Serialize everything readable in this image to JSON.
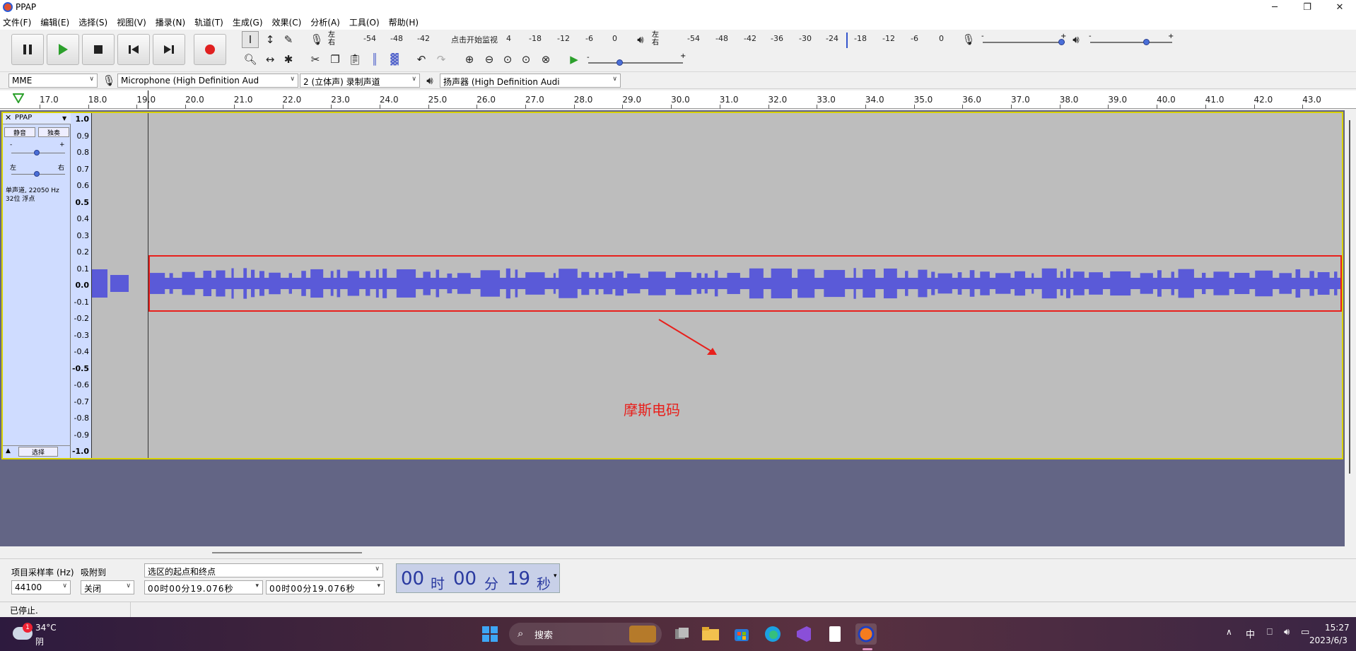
{
  "window": {
    "title": "PPAP"
  },
  "menu": [
    "文件(F)",
    "编辑(E)",
    "选择(S)",
    "视图(V)",
    "播录(N)",
    "轨道(T)",
    "生成(G)",
    "效果(C)",
    "分析(A)",
    "工具(O)",
    "帮助(H)"
  ],
  "meter": {
    "rec_label_top": "左",
    "rec_label_bottom": "右",
    "rec_scale": [
      "-54",
      "-48",
      "-42",
      "点击开始监视",
      "4",
      "-18",
      "-12",
      "-6",
      "0"
    ],
    "play_scale": [
      "-54",
      "-48",
      "-42",
      "-36",
      "-30",
      "-24",
      "-18",
      "-12",
      "-6",
      "0"
    ],
    "minus": "-",
    "plus": "+"
  },
  "devices": {
    "host": "MME",
    "mic": "Microphone (High Definition Aud",
    "channels": "2 (立体声) 录制声道",
    "speaker": "扬声器 (High Definition Audi"
  },
  "ruler": [
    "17.0",
    "18.0",
    "19.0",
    "20.0",
    "21.0",
    "22.0",
    "23.0",
    "24.0",
    "25.0",
    "26.0",
    "27.0",
    "28.0",
    "29.0",
    "30.0",
    "31.0",
    "32.0",
    "33.0",
    "34.0",
    "35.0",
    "36.0",
    "37.0",
    "38.0",
    "39.0",
    "40.0",
    "41.0",
    "42.0",
    "43.0"
  ],
  "track": {
    "name": "PPAP",
    "mute": "静音",
    "solo": "独奏",
    "gain_minus": "-",
    "gain_plus": "+",
    "pan_left": "左",
    "pan_right": "右",
    "info_line1": "单声道, 22050 Hz",
    "info_line2": "32位 浮点",
    "select": "选择",
    "vscale": [
      "1.0",
      "0.9",
      "0.8",
      "0.7",
      "0.6",
      "0.5",
      "0.4",
      "0.3",
      "0.2",
      "0.1",
      "0.0",
      "-0.1",
      "-0.2",
      "-0.3",
      "-0.4",
      "-0.5",
      "-0.6",
      "-0.7",
      "-0.8",
      "-0.9",
      "-1.0"
    ]
  },
  "annotation": {
    "text": "摩斯电码",
    "color": "#e8201c"
  },
  "selection": {
    "rate_label": "项目采样率 (Hz)",
    "rate_value": "44100",
    "snap_label": "吸附到",
    "snap_value": "关闭",
    "mode": "选区的起点和终点",
    "start": "00时00分19.076秒",
    "end": "00时00分19.076秒",
    "time_h": "00",
    "time_h_unit": "时",
    "time_m": "00",
    "time_m_unit": "分",
    "time_s": "19",
    "time_s_unit": "秒"
  },
  "status": "已停止.",
  "taskbar": {
    "weather_temp": "34°C",
    "weather_desc": "阴",
    "weather_badge": "1",
    "search": "搜索",
    "ime": "中",
    "time": "15:27",
    "date": "2023/6/3"
  },
  "colors": {
    "wave": "#5a5ad8",
    "track_bg": "#bdbdbd",
    "selected_border": "#d8d200"
  }
}
